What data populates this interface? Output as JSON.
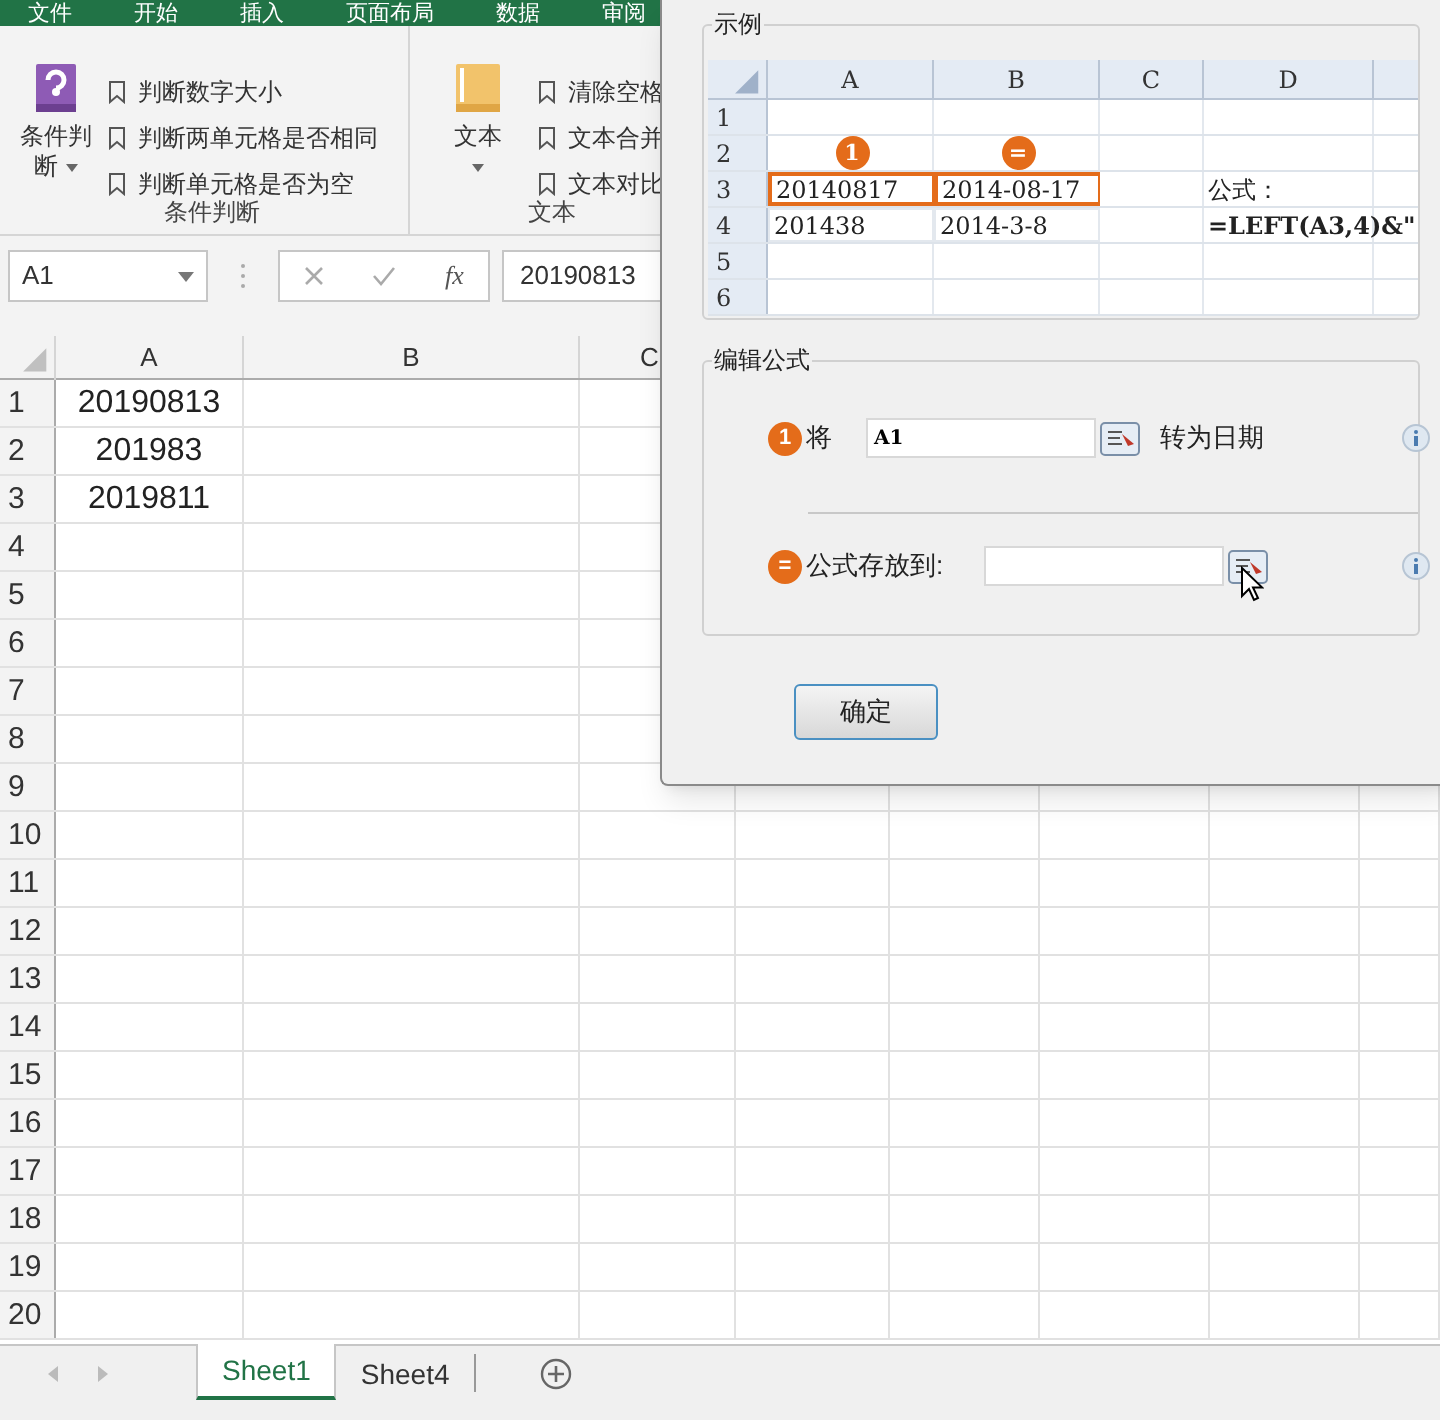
{
  "ribbon_tabs": [
    "文件",
    "开始",
    "插入",
    "页面布局",
    "数据",
    "审阅"
  ],
  "ribbon_groups": [
    {
      "kind": "condition",
      "button": "条件判",
      "button_line2": "断",
      "items": [
        "判断数字大小",
        "判断两单元格是否相同",
        "判断单元格是否为空"
      ],
      "label": "条件判断"
    },
    {
      "kind": "text",
      "button": "文本",
      "items": [
        "清除空格",
        "文本合并",
        "文本对比"
      ],
      "label": "文本"
    }
  ],
  "formula_bar": {
    "name_box": "A1",
    "function_label": "fx",
    "value": "20190813"
  },
  "sheet": {
    "columns": [
      "A",
      "B",
      "C"
    ],
    "rows": [
      {
        "number": "1",
        "cells": [
          "20190813"
        ]
      },
      {
        "number": "2",
        "cells": [
          "201983"
        ]
      },
      {
        "number": "3",
        "cells": [
          "2019811"
        ]
      },
      {
        "number": "4"
      },
      {
        "number": "5"
      },
      {
        "number": "6"
      },
      {
        "number": "7"
      },
      {
        "number": "8"
      },
      {
        "number": "9"
      },
      {
        "number": "10"
      },
      {
        "number": "11"
      },
      {
        "number": "12"
      },
      {
        "number": "13"
      },
      {
        "number": "14"
      },
      {
        "number": "15"
      },
      {
        "number": "16"
      },
      {
        "number": "17"
      },
      {
        "number": "18"
      },
      {
        "number": "19"
      },
      {
        "number": "20"
      }
    ]
  },
  "sheet_tabs": [
    {
      "label": "Sheet1",
      "selected": true
    },
    {
      "label": "Sheet4",
      "selected": false
    }
  ],
  "dialog": {
    "example_title": "示例",
    "example_sheet": {
      "columns": [
        "A",
        "B",
        "C",
        "D"
      ],
      "rows": [
        {
          "number": "1",
          "cells": [
            "",
            "",
            "",
            ""
          ]
        },
        {
          "number": "2",
          "cells": [
            "",
            "",
            "",
            ""
          ]
        },
        {
          "number": "3",
          "cells": [
            "20140817",
            "2014-08-17",
            "",
            "公式："
          ]
        },
        {
          "number": "4",
          "cells": [
            "201438",
            "2014-3-8",
            "",
            "=LEFT(A3,4)&\""
          ]
        },
        {
          "number": "5",
          "cells": [
            "",
            "",
            "",
            ""
          ]
        },
        {
          "number": "6",
          "cells": [
            "",
            "",
            "",
            ""
          ]
        }
      ],
      "badges": [
        "1",
        "="
      ]
    },
    "edit_title": "编辑公式",
    "steps": [
      {
        "badge": "1",
        "label": "将",
        "value": "A1",
        "suffix": "转为日期"
      },
      {
        "badge": "=",
        "label": "公式存放到:"
      }
    ],
    "ok_button": "确定"
  }
}
